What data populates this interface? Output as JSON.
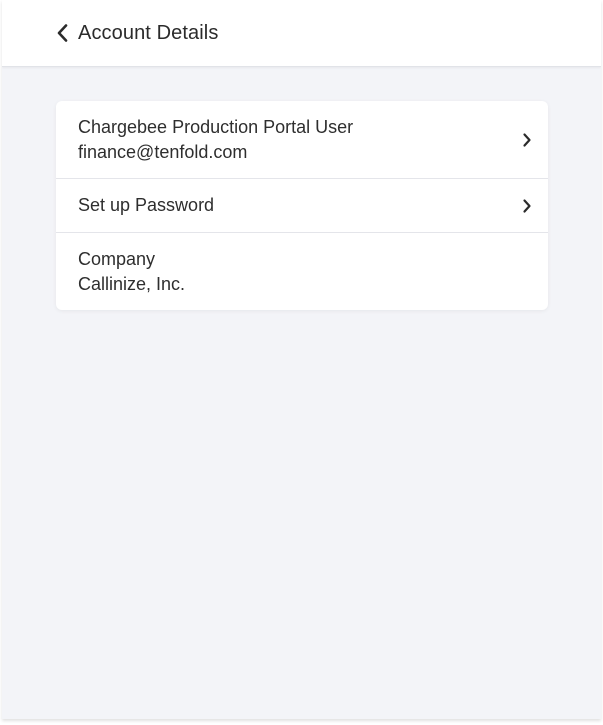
{
  "header": {
    "back_label": "Account Details"
  },
  "account": {
    "rows": [
      {
        "primary": "Chargebee Production Portal User",
        "secondary": "finance@tenfold.com"
      },
      {
        "primary": "Set up Password"
      },
      {
        "primary": "Company",
        "secondary": "Callinize, Inc."
      }
    ]
  },
  "icons": {
    "back": "chevron-left-icon",
    "row_arrow": "chevron-right-icon"
  },
  "colors": {
    "background": "#f3f4f8",
    "card": "#ffffff",
    "text": "#2e2e2e",
    "divider": "#e4e5ea"
  }
}
